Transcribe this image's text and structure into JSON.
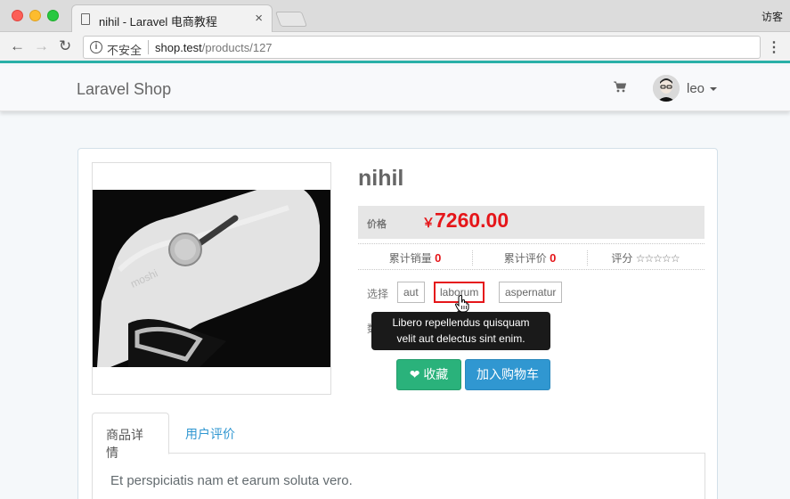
{
  "browser": {
    "tab_title": "nihil - Laravel 电商教程",
    "tab_close": "×",
    "guest_label": "访客",
    "insecure_label": "不安全",
    "url_host": "shop.test",
    "url_path": "/products/127",
    "back_glyph": "←",
    "forward_glyph": "→",
    "reload_glyph": "↻",
    "menu_glyph": "⋮"
  },
  "navbar": {
    "brand": "Laravel Shop",
    "user_name": "leo"
  },
  "product": {
    "title": "nihil",
    "price_label": "价格",
    "currency": "￥",
    "price": "7260.00",
    "sold_label": "累计销量",
    "sold_count": "0",
    "review_label": "累计评价",
    "review_count": "0",
    "rating_label": "评分",
    "rating_stars": "☆☆☆☆☆",
    "select_label": "选择",
    "skus": [
      "aut",
      "laborum",
      "aspernatur"
    ],
    "qty_label_partial": "数",
    "tooltip": [
      "Libero repellendus quisquam",
      "velit aut delectus sint enim."
    ],
    "fav_button": "收藏",
    "cart_button": "加入购物车"
  },
  "tabs": {
    "details": "商品详情",
    "reviews": "用户评价"
  },
  "description": "Et perspiciatis nam et earum soluta vero.",
  "colors": {
    "price": "#e5161a",
    "fav_button": "#2ab27b",
    "cart_button": "#3097d1",
    "accent_line": "#2ab0a8"
  }
}
